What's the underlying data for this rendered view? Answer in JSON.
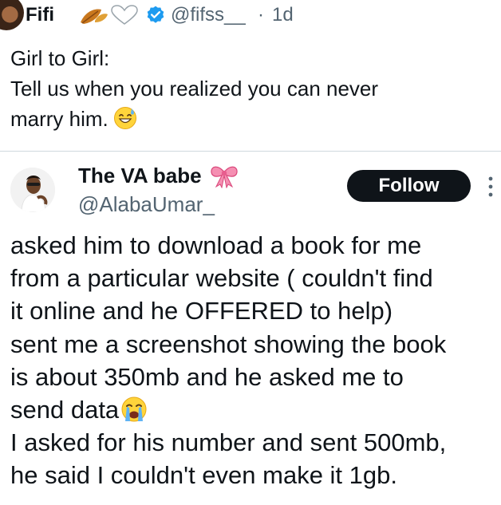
{
  "top_tweet": {
    "display_name": "Fifi",
    "name_emojis": [
      "fallen-leaf-icon",
      "white-heart-icon"
    ],
    "verified_icon": "verified-badge-icon",
    "handle": "@fifss__",
    "separator": "·",
    "time": "1d",
    "lines": [
      "Girl to Girl:",
      "Tell us when you realized you can never",
      "marry him."
    ],
    "trailing_emoji": "sweat-smile-icon"
  },
  "reply_tweet": {
    "display_name": "The VA babe",
    "name_emoji": "ribbon-bow-icon",
    "handle": "@AlabaUmar_",
    "follow_label": "Follow",
    "more_icon": "more-vertical-icon",
    "lines": [
      "asked him to download a book for me",
      "from a particular website ( couldn't find",
      "it online and he OFFERED to help)",
      "sent me a screenshot showing the book",
      "is about 350mb and he asked me to",
      "send data",
      "I asked for his number and sent 500mb,",
      "he said I couldn't even make it 1gb."
    ],
    "inline_emoji": "loudly-crying-icon"
  },
  "colors": {
    "text": "#0f1419",
    "secondary": "#536471",
    "verified": "#1d9bf0",
    "button_bg": "#0f1419",
    "divider": "#cfd9de"
  }
}
